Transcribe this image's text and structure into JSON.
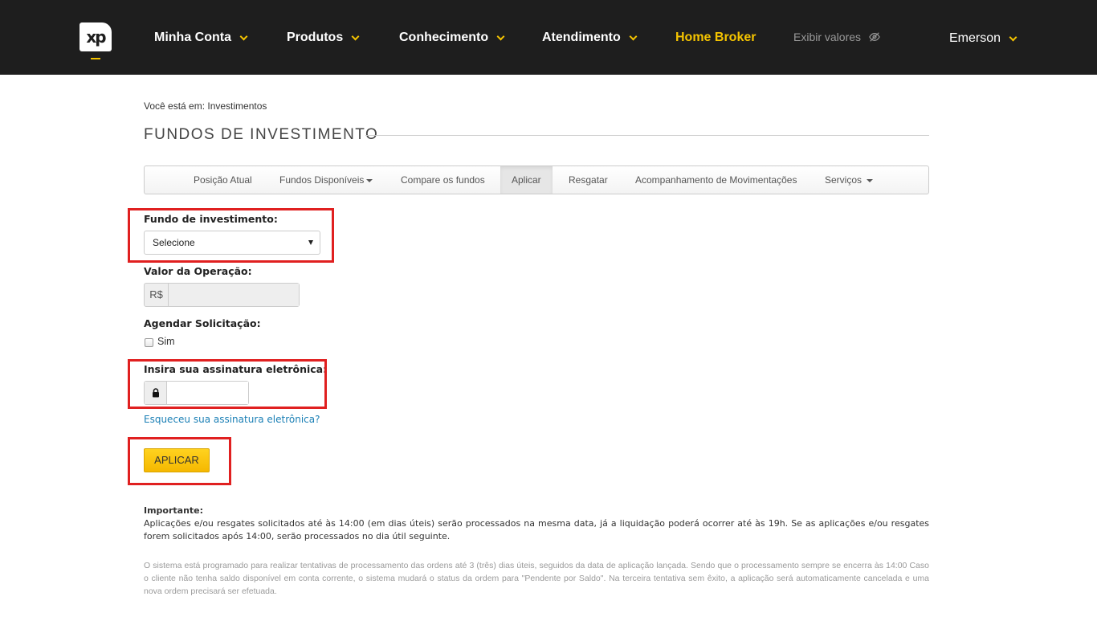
{
  "header": {
    "logo_text": "xp",
    "nav": [
      {
        "label": "Minha Conta"
      },
      {
        "label": "Produtos"
      },
      {
        "label": "Conhecimento"
      },
      {
        "label": "Atendimento"
      },
      {
        "label": "Home Broker"
      }
    ],
    "exibir_valores": "Exibir valores",
    "user_name": "Emerson"
  },
  "breadcrumb": "Você está em: Investimentos",
  "page_title": "FUNDOS DE INVESTIMENTO",
  "tabs": [
    {
      "label": "Posição Atual"
    },
    {
      "label": "Fundos Disponíveis"
    },
    {
      "label": "Compare os fundos"
    },
    {
      "label": "Aplicar",
      "active": true
    },
    {
      "label": "Resgatar"
    },
    {
      "label": "Acompanhamento de Movimentações"
    },
    {
      "label": "Serviços"
    }
  ],
  "form": {
    "fund_label": "Fundo de investimento:",
    "fund_selected": "Selecione",
    "value_label": "Valor da Operação:",
    "currency": "R$",
    "value": "",
    "schedule_label": "Agendar Solicitação:",
    "schedule_option": "Sim",
    "signature_label": "Insira sua assinatura eletrônica:",
    "signature_value": "",
    "forgot_link": "Esqueceu sua assinatura eletrônica?",
    "apply_button": "APLICAR"
  },
  "notes": {
    "important_title": "Importante:",
    "important_text": "Aplicações e/ou resgates solicitados até às 14:00 (em dias úteis) serão processados na mesma data, já a liquidação poderá ocorrer até às 19h. Se as aplicações e/ou resgates forem solicitados após 14:00, serão processados no dia útil seguinte.",
    "system_note": "O sistema está programado para realizar tentativas de processamento das ordens até 3 (três) dias úteis, seguidos da data de aplicação lançada. Sendo que o processamento sempre se encerra às 14:00 Caso o cliente não tenha saldo disponível em conta corrente, o sistema mudará o status da ordem para \"Pendente por Saldo\". Na terceira tentativa sem êxito, a aplicação será automaticamente cancelada e uma nova ordem precisará ser efetuada."
  },
  "colors": {
    "topbar": "#1e1e1e",
    "accent": "#f5c400",
    "highlight_box": "#e02020",
    "link": "#1a7fb5"
  }
}
